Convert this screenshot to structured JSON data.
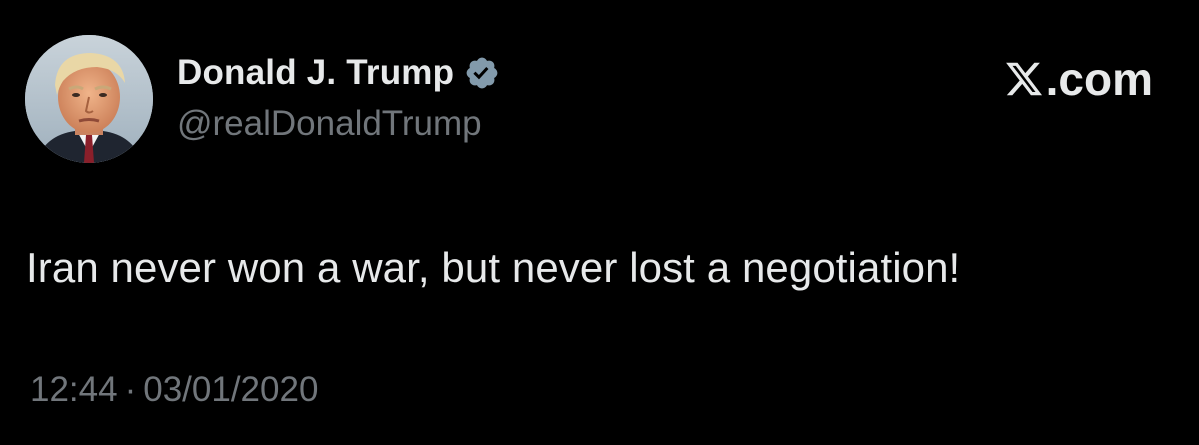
{
  "tweet": {
    "author": {
      "display_name": "Donald J. Trump",
      "handle": "@realDonaldTrump",
      "verified": true,
      "avatar_icon": "portrait-avatar"
    },
    "brand": {
      "logo_icon": "x-logo-icon",
      "domain_suffix": ".com"
    },
    "text": "Iran never won a war, but never lost a negotiation!",
    "meta": {
      "time": "12:44",
      "separator": "·",
      "date": "03/01/2020"
    }
  },
  "colors": {
    "background": "#000000",
    "primary_text": "#e7e9ea",
    "secondary_text": "#71767b",
    "verified_badge": "#829aab"
  }
}
